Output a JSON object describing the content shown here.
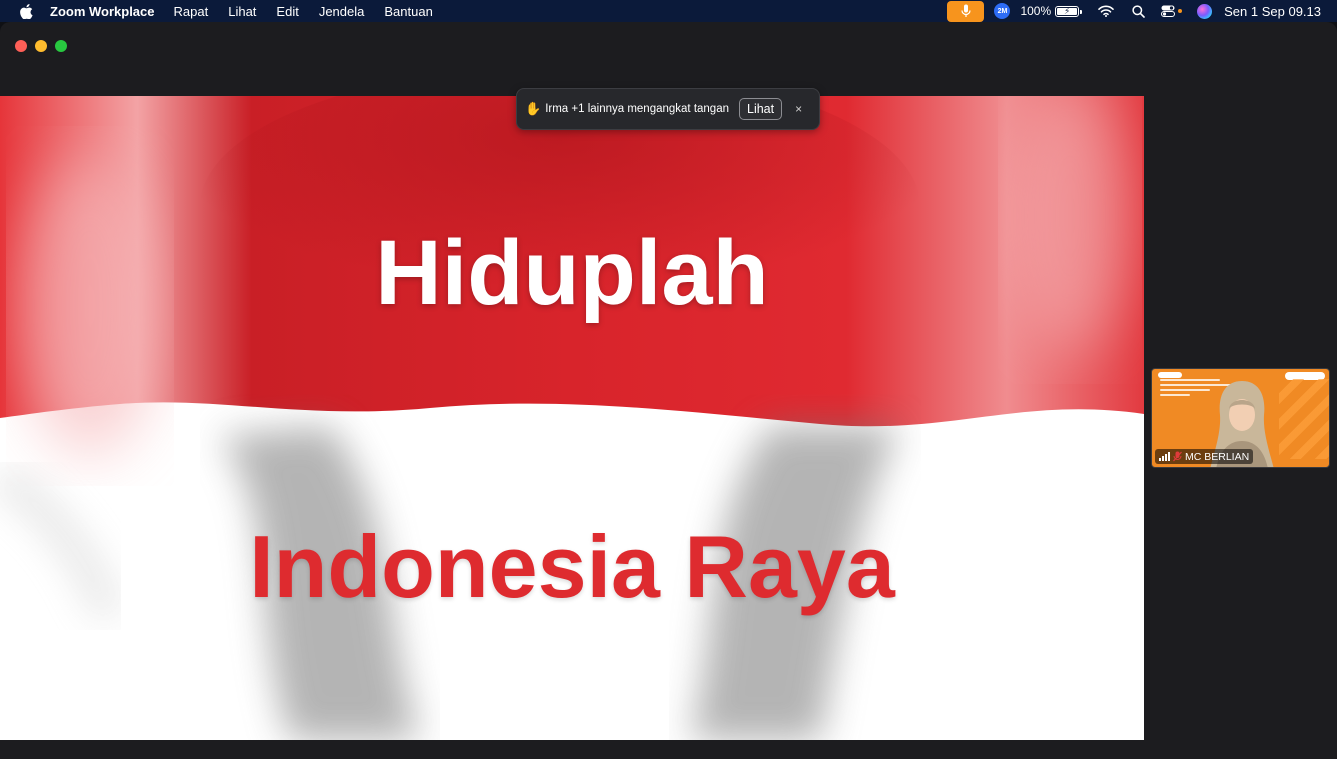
{
  "menubar": {
    "app_name": "Zoom Workplace",
    "menu_items": [
      "Rapat",
      "Lihat",
      "Edit",
      "Jendela",
      "Bantuan"
    ],
    "zoom_badge": "2M",
    "battery_percent": "100%",
    "clock": "Sen 1 Sep  09.13",
    "icons": [
      "apple-icon",
      "microphone-icon",
      "zoom-icon",
      "battery-icon",
      "wifi-icon",
      "search-icon",
      "control-center-icon",
      "siri-icon"
    ],
    "mic_color": "#f7941d"
  },
  "window": {
    "traffic_lights": [
      "close",
      "minimize",
      "zoom"
    ]
  },
  "shared_screen": {
    "line1": "Hiduplah",
    "line2": "Indonesia Raya",
    "flag_colors": {
      "red": "#d9252b",
      "white": "#ffffff"
    }
  },
  "notification": {
    "icon": "raised-hand-icon",
    "message": "Irma +1 lainnya mengangkat tangan",
    "view_label": "Lihat",
    "close_label": "×"
  },
  "participant": {
    "name": "MC BERLIAN",
    "muted": true,
    "background_color": "#f08a24"
  }
}
